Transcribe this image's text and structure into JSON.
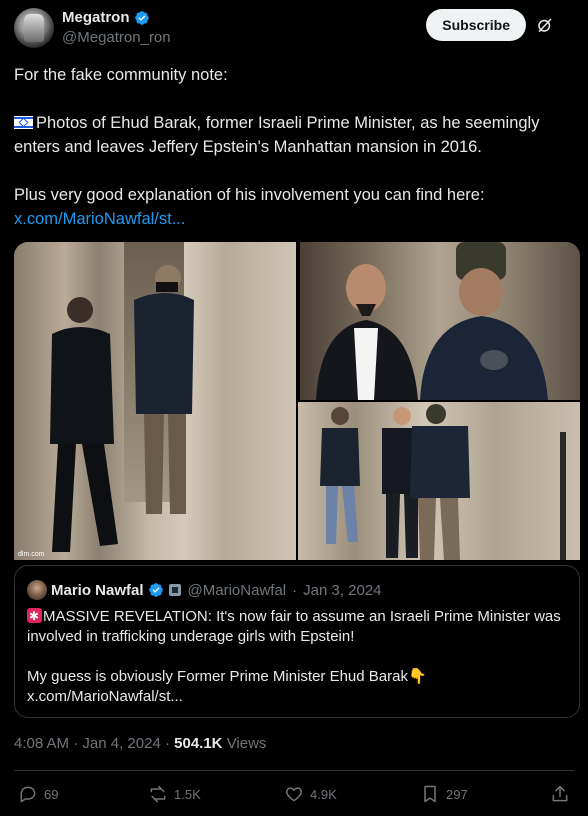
{
  "author": {
    "name": "Megatron",
    "handle": "@Megatron_ron",
    "subscribe_label": "Subscribe"
  },
  "tweet": {
    "line1": "For the fake community note:",
    "line2_flag": "israel-flag-icon",
    "line2": "Photos of Ehud Barak, former Israeli Prime Minister, as he seemingly enters and leaves Jeffery Epstein's Manhattan mansion in 2016.",
    "line3": "Plus very good explanation of his involvement you can find here:",
    "link": "x.com/MarioNawfal/st..."
  },
  "photos": {
    "watermark": "dlm.com"
  },
  "quote": {
    "name": "Mario Nawfal",
    "handle": "@MarioNawfal",
    "separator": "·",
    "date": "Jan 3, 2024",
    "text1": "MASSIVE REVELATION: It's now fair to assume an Israeli Prime Minister was involved in trafficking underage girls with Epstein!",
    "text2": "My guess is obviously Former Prime Minister Ehud Barak",
    "link": "x.com/MarioNawfal/st..."
  },
  "meta": {
    "time": "4:08 AM",
    "separator": "·",
    "date": "Jan 4, 2024",
    "separator2": "·",
    "views_count": "504.1K",
    "views_label": "Views"
  },
  "actions": {
    "replies": "69",
    "reposts": "1.5K",
    "likes": "4.9K",
    "bookmarks": "297"
  },
  "colors": {
    "background": "#000000",
    "text": "#e7e9ea",
    "muted": "#71767b",
    "link": "#1d9bf0",
    "border": "#2f3336",
    "verified": "#1d9bf0"
  }
}
